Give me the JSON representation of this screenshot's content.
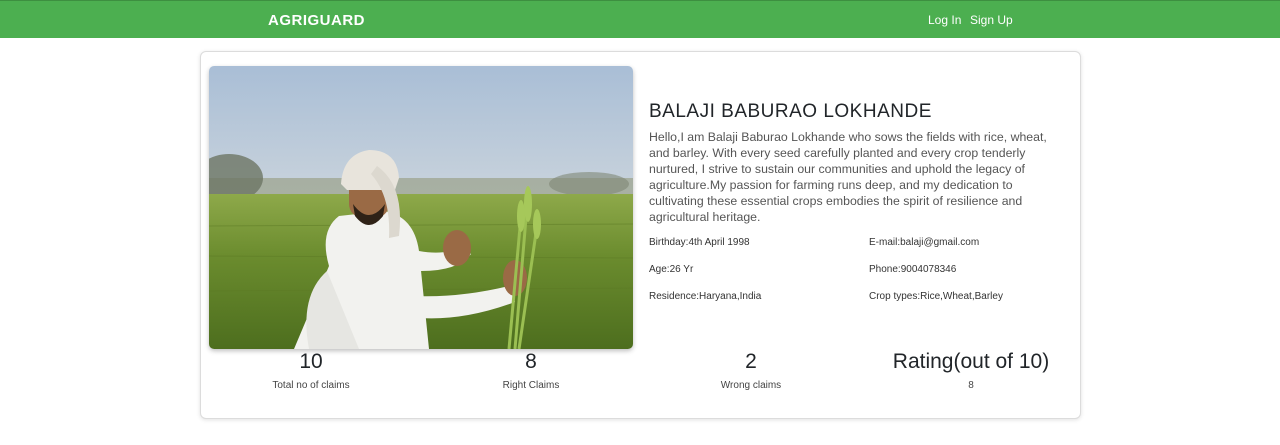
{
  "navbar": {
    "brand": "AGRIGUARD",
    "login_label": "Log In",
    "signup_label": "Sign Up"
  },
  "profile": {
    "photo_alt": "Farmer holding wheat in a field",
    "name": "BALAJI BABURAO LOKHANDE",
    "bio": "Hello,I am Balaji Baburao Lokhande who sows the fields with rice, wheat, and barley. With every seed carefully planted and every crop tenderly nurtured, I strive to sustain our communities and uphold the legacy of agriculture.My passion for farming runs deep, and my dedication to cultivating these essential crops embodies the spirit of resilience and agricultural heritage.",
    "birthday": "Birthday:4th April 1998",
    "email": "E-mail:balaji@gmail.com",
    "age": "Age:26 Yr",
    "phone": "Phone:9004078346",
    "residence": "Residence:Haryana,India",
    "crop_types": "Crop types:Rice,Wheat,Barley"
  },
  "stats": [
    {
      "value": "10",
      "label": "Total no of claims"
    },
    {
      "value": "8",
      "label": "Right Claims"
    },
    {
      "value": "2",
      "label": "Wrong claims"
    },
    {
      "value": "Rating(out of 10)",
      "label": "8"
    }
  ]
}
